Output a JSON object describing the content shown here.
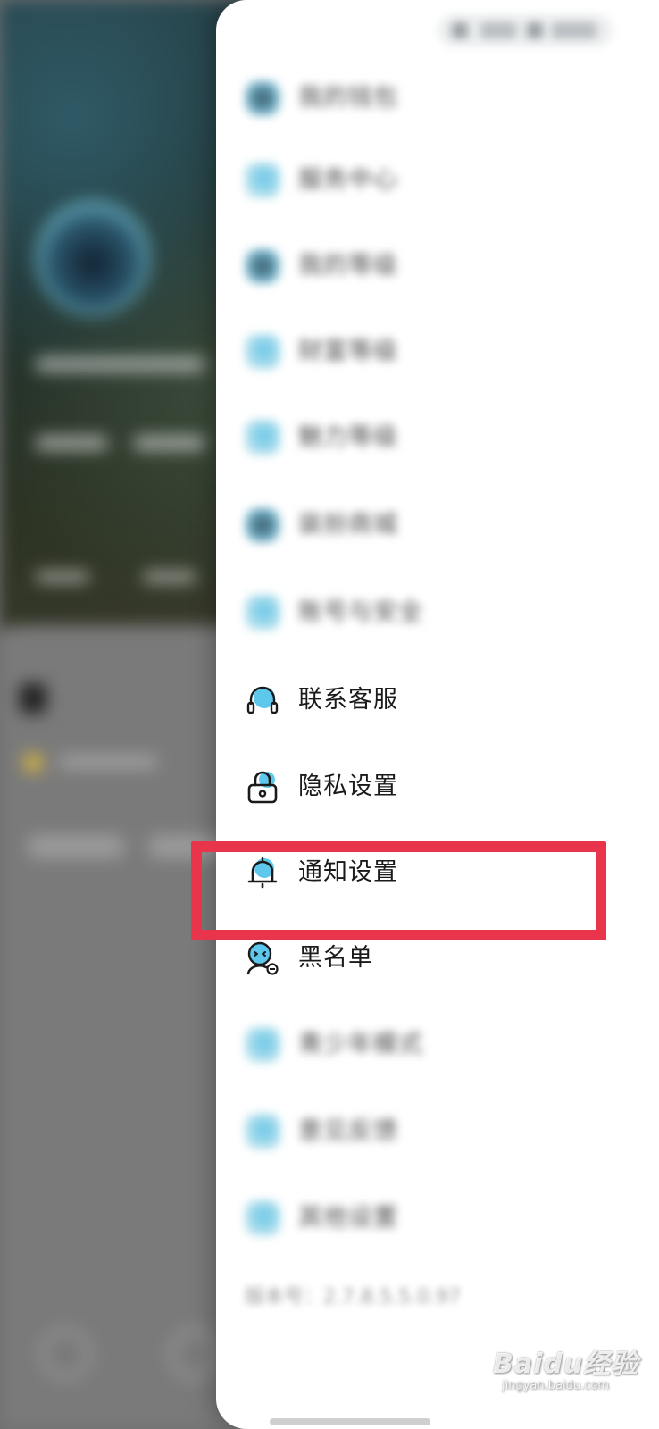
{
  "drawer": {
    "menu": [
      {
        "label": "我的钱包",
        "icon": "wallet-icon",
        "blurred": true
      },
      {
        "label": "服务中心",
        "icon": "service-center-icon",
        "blurred": true
      },
      {
        "label": "我的等级",
        "icon": "level-icon",
        "blurred": true
      },
      {
        "label": "财富等级",
        "icon": "wealth-level-icon",
        "blurred": true
      },
      {
        "label": "魅力等级",
        "icon": "charm-level-icon",
        "blurred": true
      },
      {
        "label": "装扮商城",
        "icon": "store-icon",
        "blurred": true
      },
      {
        "label": "账号与安全",
        "icon": "account-security-icon",
        "blurred": true
      },
      {
        "label": "联系客服",
        "icon": "headset-icon",
        "blurred": false
      },
      {
        "label": "隐私设置",
        "icon": "lock-icon",
        "blurred": false
      },
      {
        "label": "通知设置",
        "icon": "bell-icon",
        "blurred": false,
        "highlighted": true
      },
      {
        "label": "黑名单",
        "icon": "blacklist-icon",
        "blurred": false
      },
      {
        "label": "青少年模式",
        "icon": "teen-mode-icon",
        "blurred": true
      },
      {
        "label": "意见反馈",
        "icon": "feedback-icon",
        "blurred": true
      },
      {
        "label": "其他设置",
        "icon": "other-settings-icon",
        "blurred": true
      }
    ],
    "version_text": "版本号：2.7.8.5.5.0.97"
  },
  "watermark": {
    "brand": "Baidu经验",
    "sub": "jingyan.baidu.com"
  },
  "colors": {
    "highlight": "#e8354b",
    "icon_accent": "#5ec8ec",
    "drawer_bg": "#ffffff"
  }
}
